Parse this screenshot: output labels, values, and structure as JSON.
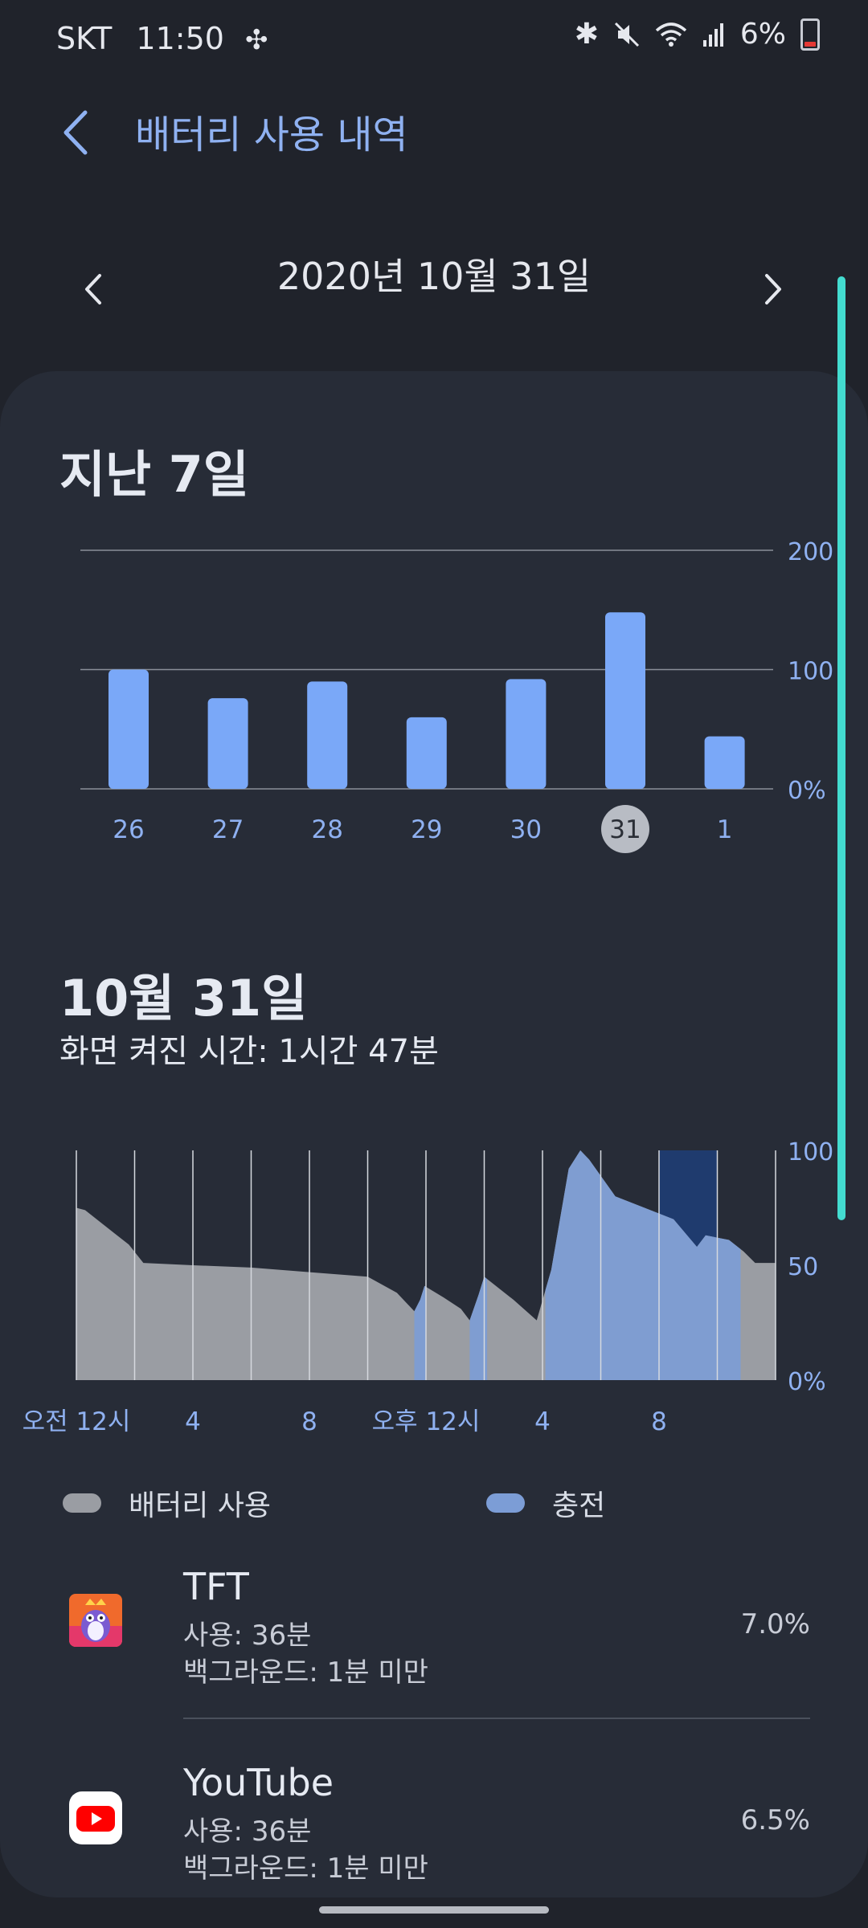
{
  "status_bar": {
    "carrier": "SKT",
    "time": "11:50",
    "battery_percent": "6%"
  },
  "header": {
    "title": "배터리 사용 내역"
  },
  "date_nav": {
    "date": "2020년 10월 31일"
  },
  "weekly": {
    "title": "지난 7일"
  },
  "daily": {
    "title": "10월 31일",
    "screen_on_time": "화면 켜진 시간: 1시간 47분"
  },
  "legend": {
    "battery_usage": "배터리 사용",
    "charging": "충전"
  },
  "apps": [
    {
      "name": "TFT",
      "usage": "사용: 36분",
      "background": "백그라운드: 1분 미만",
      "percent": "7.0%"
    },
    {
      "name": "YouTube",
      "usage": "사용: 36분",
      "background": "백그라운드: 1분 미만",
      "percent": "6.5%"
    }
  ],
  "colors": {
    "accent": "#8fb1f1",
    "bar": "#7aa8f8",
    "usage_area": "#9a9da3",
    "charge_area": "#7c9dd6",
    "highlight": "#1f3b6e",
    "scrollbar": "#43dcd0"
  },
  "chart_data": [
    {
      "type": "bar",
      "categories": [
        "26",
        "27",
        "28",
        "29",
        "30",
        "31",
        "1"
      ],
      "values": [
        100,
        76,
        90,
        60,
        92,
        148,
        44
      ],
      "selected": "31",
      "ylim": [
        0,
        200
      ],
      "y_ticks": [
        "0%",
        "100",
        "200"
      ],
      "grid": true
    },
    {
      "type": "area",
      "x_tick_labels": [
        "오전 12시",
        "4",
        "8",
        "오후 12시",
        "4",
        "8"
      ],
      "x_ticks_hours": [
        0,
        4,
        8,
        12,
        16,
        20
      ],
      "xlim_hours": [
        0,
        24
      ],
      "ylim": [
        0,
        100
      ],
      "y_ticks": [
        "0%",
        "50",
        "100"
      ],
      "battery_level": [
        [
          0,
          75
        ],
        [
          0.3,
          74
        ],
        [
          1.3,
          64
        ],
        [
          1.8,
          59
        ],
        [
          2.3,
          51
        ],
        [
          4,
          50
        ],
        [
          6,
          49
        ],
        [
          8,
          47
        ],
        [
          10,
          45
        ],
        [
          11,
          38
        ],
        [
          11.6,
          30
        ],
        [
          11.8,
          35
        ],
        [
          11.95,
          41
        ],
        [
          12.6,
          36
        ],
        [
          13.2,
          31
        ],
        [
          13.5,
          26
        ],
        [
          13.8,
          37
        ],
        [
          14,
          45
        ],
        [
          15,
          35
        ],
        [
          15.8,
          26
        ],
        [
          16.3,
          48
        ],
        [
          16.9,
          92
        ],
        [
          17.3,
          100
        ],
        [
          17.6,
          96
        ],
        [
          18.5,
          80
        ],
        [
          19.5,
          75
        ],
        [
          20.5,
          70
        ],
        [
          21.3,
          58
        ],
        [
          21.6,
          63
        ],
        [
          22.4,
          61
        ],
        [
          22.9,
          56
        ],
        [
          23.3,
          51
        ],
        [
          24,
          51
        ]
      ],
      "charging_periods": [
        [
          11.6,
          12
        ],
        [
          13.5,
          14.1
        ],
        [
          16.1,
          22.8
        ]
      ],
      "highlight_range": [
        20,
        22
      ],
      "grid": true
    }
  ]
}
